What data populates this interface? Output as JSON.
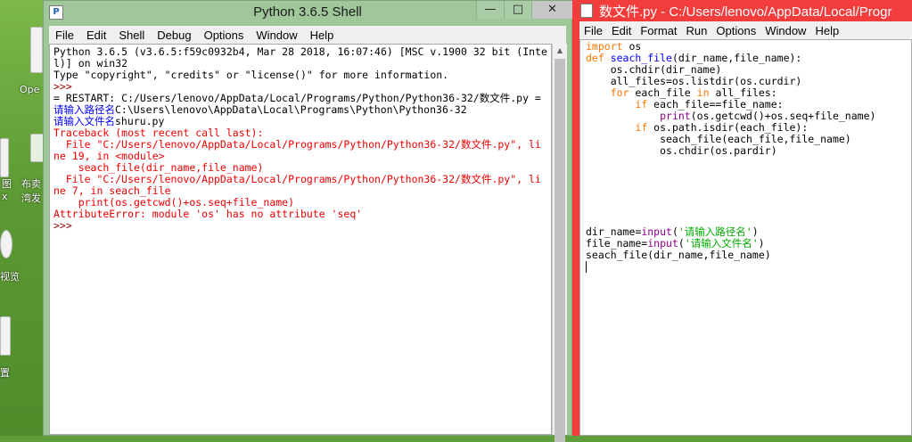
{
  "desktop": {
    "labels": [
      "Ope",
      "图",
      "x",
      "布卖",
      "湾发",
      "视览",
      "置"
    ]
  },
  "shell": {
    "title": "Python 3.6.5 Shell",
    "menu": [
      "File",
      "Edit",
      "Shell",
      "Debug",
      "Options",
      "Window",
      "Help"
    ],
    "buttons": {
      "minimize": "—",
      "maximize": "□",
      "close": "✕"
    },
    "lines": [
      {
        "text": "Python 3.6.5 (v3.6.5:f59c0932b4, Mar 28 2018, 16:07:46) [MSC v.1900 32 bit (Inte",
        "color": "blk"
      },
      {
        "text": "l)] on win32",
        "color": "blk"
      },
      {
        "text": "Type \"copyright\", \"credits\" or \"license()\" for more information.",
        "color": "blk"
      },
      {
        "text": ">>>",
        "color": "prompt"
      },
      {
        "text": "= RESTART: C:/Users/lenovo/AppData/Local/Programs/Python/Python36-32/数文件.py =",
        "color": "restart"
      },
      {
        "text": "请输入路径名C:\\Users\\lenovo\\AppData\\Local\\Programs\\Python\\Python36-32",
        "color": "mixed1"
      },
      {
        "text": "请输入文件名shuru.py",
        "color": "mixed2"
      },
      {
        "text": "Traceback (most recent call last):",
        "color": "red"
      },
      {
        "text": "  File \"C:/Users/lenovo/AppData/Local/Programs/Python/Python36-32/数文件.py\", li",
        "color": "red"
      },
      {
        "text": "ne 19, in <module>",
        "color": "red"
      },
      {
        "text": "    seach_file(dir_name,file_name)",
        "color": "red"
      },
      {
        "text": "  File \"C:/Users/lenovo/AppData/Local/Programs/Python/Python36-32/数文件.py\", li",
        "color": "red"
      },
      {
        "text": "ne 7, in seach_file",
        "color": "red"
      },
      {
        "text": "    print(os.getcwd()+os.seq+file_name)",
        "color": "red"
      },
      {
        "text": "AttributeError: module 'os' has no attribute 'seq'",
        "color": "red"
      },
      {
        "text": ">>>",
        "color": "prompt"
      }
    ],
    "prompt_1": "请输入路径名",
    "input_1": "C:\\Users\\lenovo\\AppData\\Local\\Programs\\Python\\Python36-32",
    "prompt_2": "请输入文件名",
    "input_2": "shuru.py"
  },
  "editor": {
    "title": "数文件.py - C:/Users/lenovo/AppData/Local/Progr",
    "menu": [
      "File",
      "Edit",
      "Format",
      "Run",
      "Options",
      "Window",
      "Help"
    ],
    "code": {
      "l1_kw": "import",
      "l1_rest": " os",
      "l2_kw": "def",
      "l2_fn": " seach_file",
      "l2_rest": "(dir_name,file_name):",
      "l3": "    os.chdir(dir_name)",
      "l4": "    all_files=os.listdir(os.curdir)",
      "l5_kw": "for",
      "l5_a": " each_file ",
      "l5_kw2": "in",
      "l5_b": " all_files:",
      "l6_kw": "if",
      "l6_rest": " each_file==file_name:",
      "l7_bi": "print",
      "l7_rest": "(os.getcwd()+os.seq+file_name)",
      "l8_kw": "if",
      "l8_rest": " os.path.isdir(each_file):",
      "l9": "            seach_file(each_file,file_name)",
      "l10": "            os.chdir(os.pardir)",
      "l11_a": "dir_name=",
      "l11_bi": "input",
      "l11_b": "(",
      "l11_st": "'请输入路径名'",
      "l11_c": ")",
      "l12_a": "file_name=",
      "l12_bi": "input",
      "l12_b": "(",
      "l12_st": "'请输入文件名'",
      "l12_c": ")",
      "l13": "seach_file(dir_name,file_name)"
    }
  }
}
